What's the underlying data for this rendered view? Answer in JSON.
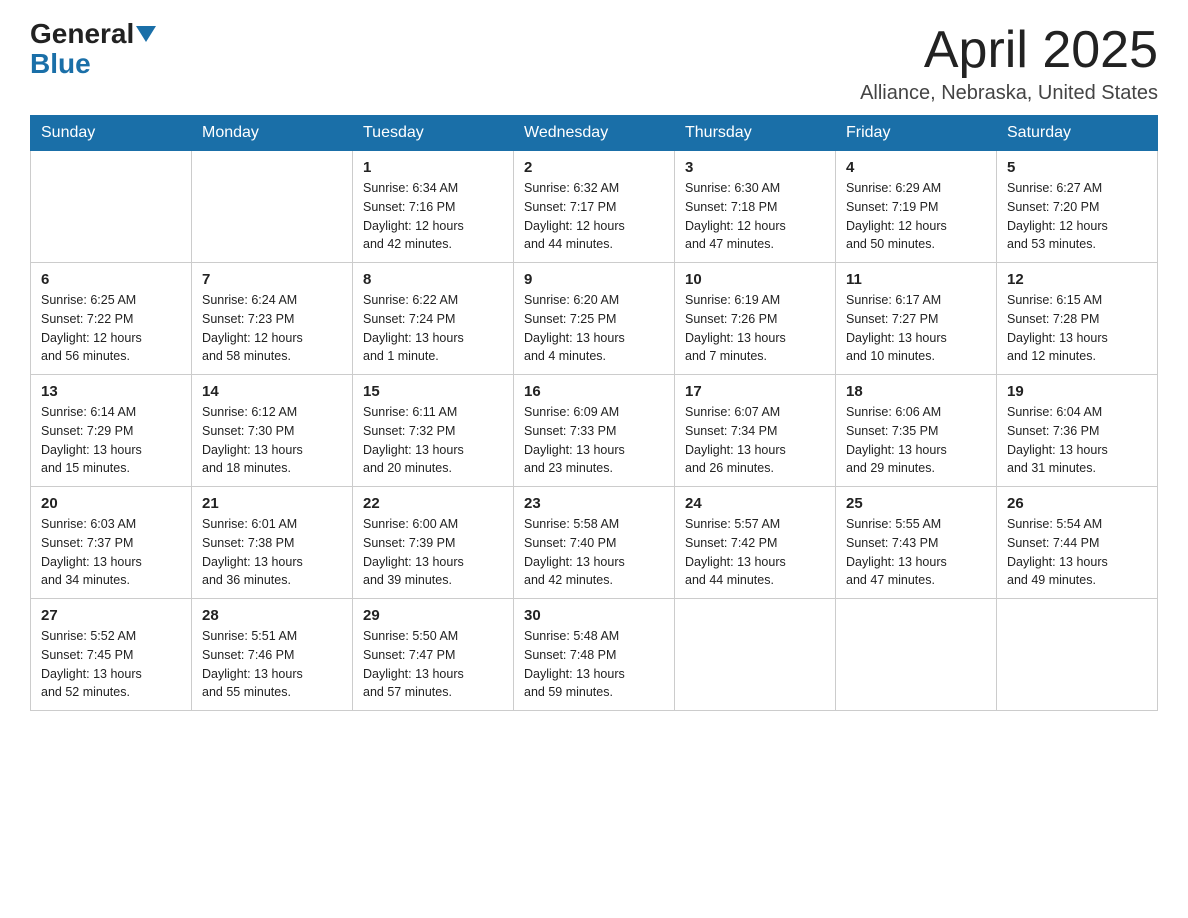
{
  "header": {
    "logo_text1": "General",
    "logo_text2": "Blue",
    "month_title": "April 2025",
    "location": "Alliance, Nebraska, United States"
  },
  "weekdays": [
    "Sunday",
    "Monday",
    "Tuesday",
    "Wednesday",
    "Thursday",
    "Friday",
    "Saturday"
  ],
  "weeks": [
    [
      {
        "day": "",
        "info": ""
      },
      {
        "day": "",
        "info": ""
      },
      {
        "day": "1",
        "info": "Sunrise: 6:34 AM\nSunset: 7:16 PM\nDaylight: 12 hours\nand 42 minutes."
      },
      {
        "day": "2",
        "info": "Sunrise: 6:32 AM\nSunset: 7:17 PM\nDaylight: 12 hours\nand 44 minutes."
      },
      {
        "day": "3",
        "info": "Sunrise: 6:30 AM\nSunset: 7:18 PM\nDaylight: 12 hours\nand 47 minutes."
      },
      {
        "day": "4",
        "info": "Sunrise: 6:29 AM\nSunset: 7:19 PM\nDaylight: 12 hours\nand 50 minutes."
      },
      {
        "day": "5",
        "info": "Sunrise: 6:27 AM\nSunset: 7:20 PM\nDaylight: 12 hours\nand 53 minutes."
      }
    ],
    [
      {
        "day": "6",
        "info": "Sunrise: 6:25 AM\nSunset: 7:22 PM\nDaylight: 12 hours\nand 56 minutes."
      },
      {
        "day": "7",
        "info": "Sunrise: 6:24 AM\nSunset: 7:23 PM\nDaylight: 12 hours\nand 58 minutes."
      },
      {
        "day": "8",
        "info": "Sunrise: 6:22 AM\nSunset: 7:24 PM\nDaylight: 13 hours\nand 1 minute."
      },
      {
        "day": "9",
        "info": "Sunrise: 6:20 AM\nSunset: 7:25 PM\nDaylight: 13 hours\nand 4 minutes."
      },
      {
        "day": "10",
        "info": "Sunrise: 6:19 AM\nSunset: 7:26 PM\nDaylight: 13 hours\nand 7 minutes."
      },
      {
        "day": "11",
        "info": "Sunrise: 6:17 AM\nSunset: 7:27 PM\nDaylight: 13 hours\nand 10 minutes."
      },
      {
        "day": "12",
        "info": "Sunrise: 6:15 AM\nSunset: 7:28 PM\nDaylight: 13 hours\nand 12 minutes."
      }
    ],
    [
      {
        "day": "13",
        "info": "Sunrise: 6:14 AM\nSunset: 7:29 PM\nDaylight: 13 hours\nand 15 minutes."
      },
      {
        "day": "14",
        "info": "Sunrise: 6:12 AM\nSunset: 7:30 PM\nDaylight: 13 hours\nand 18 minutes."
      },
      {
        "day": "15",
        "info": "Sunrise: 6:11 AM\nSunset: 7:32 PM\nDaylight: 13 hours\nand 20 minutes."
      },
      {
        "day": "16",
        "info": "Sunrise: 6:09 AM\nSunset: 7:33 PM\nDaylight: 13 hours\nand 23 minutes."
      },
      {
        "day": "17",
        "info": "Sunrise: 6:07 AM\nSunset: 7:34 PM\nDaylight: 13 hours\nand 26 minutes."
      },
      {
        "day": "18",
        "info": "Sunrise: 6:06 AM\nSunset: 7:35 PM\nDaylight: 13 hours\nand 29 minutes."
      },
      {
        "day": "19",
        "info": "Sunrise: 6:04 AM\nSunset: 7:36 PM\nDaylight: 13 hours\nand 31 minutes."
      }
    ],
    [
      {
        "day": "20",
        "info": "Sunrise: 6:03 AM\nSunset: 7:37 PM\nDaylight: 13 hours\nand 34 minutes."
      },
      {
        "day": "21",
        "info": "Sunrise: 6:01 AM\nSunset: 7:38 PM\nDaylight: 13 hours\nand 36 minutes."
      },
      {
        "day": "22",
        "info": "Sunrise: 6:00 AM\nSunset: 7:39 PM\nDaylight: 13 hours\nand 39 minutes."
      },
      {
        "day": "23",
        "info": "Sunrise: 5:58 AM\nSunset: 7:40 PM\nDaylight: 13 hours\nand 42 minutes."
      },
      {
        "day": "24",
        "info": "Sunrise: 5:57 AM\nSunset: 7:42 PM\nDaylight: 13 hours\nand 44 minutes."
      },
      {
        "day": "25",
        "info": "Sunrise: 5:55 AM\nSunset: 7:43 PM\nDaylight: 13 hours\nand 47 minutes."
      },
      {
        "day": "26",
        "info": "Sunrise: 5:54 AM\nSunset: 7:44 PM\nDaylight: 13 hours\nand 49 minutes."
      }
    ],
    [
      {
        "day": "27",
        "info": "Sunrise: 5:52 AM\nSunset: 7:45 PM\nDaylight: 13 hours\nand 52 minutes."
      },
      {
        "day": "28",
        "info": "Sunrise: 5:51 AM\nSunset: 7:46 PM\nDaylight: 13 hours\nand 55 minutes."
      },
      {
        "day": "29",
        "info": "Sunrise: 5:50 AM\nSunset: 7:47 PM\nDaylight: 13 hours\nand 57 minutes."
      },
      {
        "day": "30",
        "info": "Sunrise: 5:48 AM\nSunset: 7:48 PM\nDaylight: 13 hours\nand 59 minutes."
      },
      {
        "day": "",
        "info": ""
      },
      {
        "day": "",
        "info": ""
      },
      {
        "day": "",
        "info": ""
      }
    ]
  ]
}
